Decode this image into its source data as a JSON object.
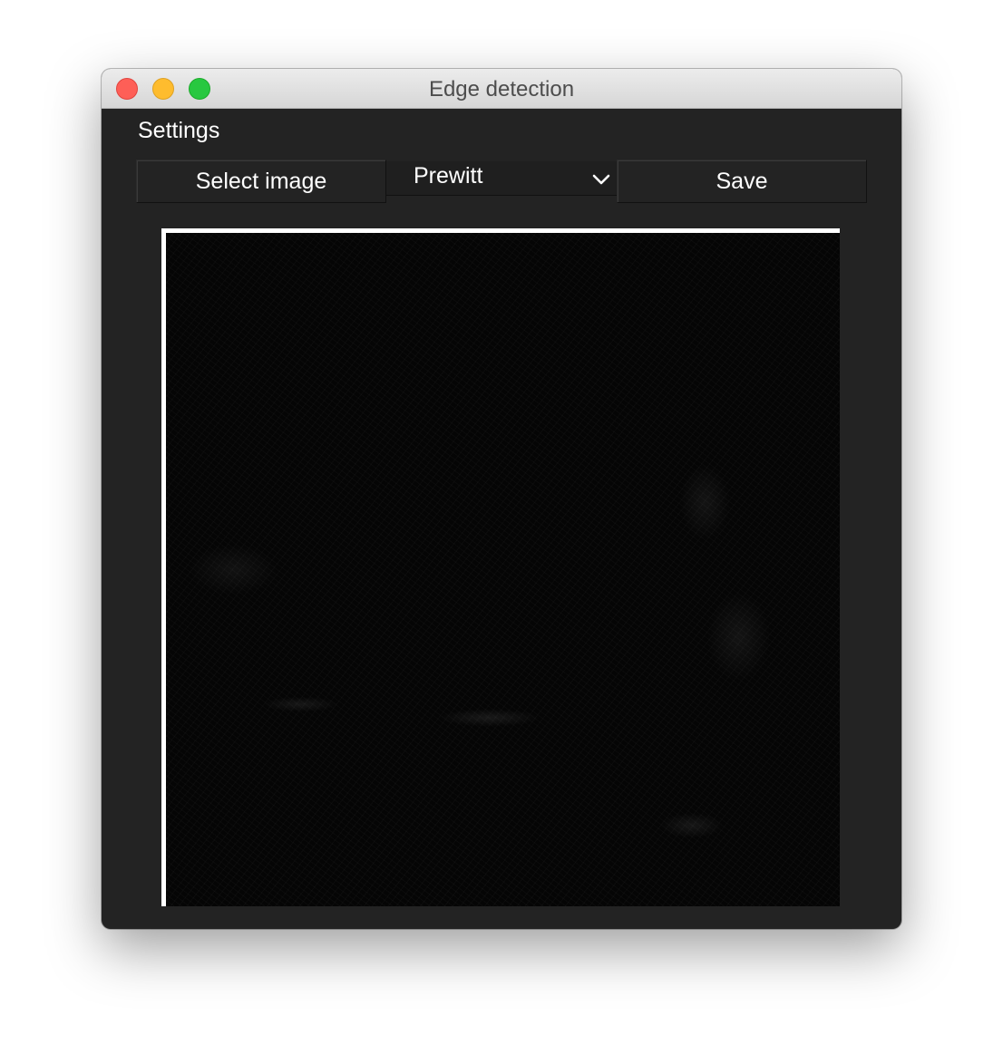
{
  "window": {
    "title": "Edge detection"
  },
  "menu": {
    "settings_label": "Settings"
  },
  "toolbar": {
    "select_image_label": "Select image",
    "filter_selected": "Prewitt",
    "save_label": "Save"
  },
  "icons": {
    "close": "close-icon",
    "minimize": "minimize-icon",
    "maximize": "maximize-icon",
    "dropdown": "chevron-down-icon"
  },
  "colors": {
    "window_bg": "#232323",
    "traffic_close": "#fe5f57",
    "traffic_minimize": "#febc2e",
    "traffic_maximize": "#28c840"
  }
}
